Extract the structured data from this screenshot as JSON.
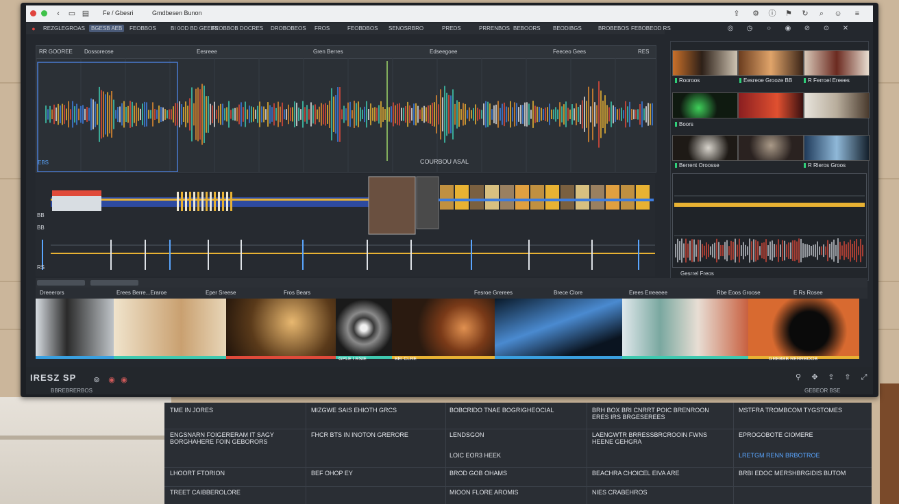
{
  "window": {
    "title_left": "Fe / Gbesri",
    "title_main": "Gmdbesen Bunon"
  },
  "toolbar": {
    "items": [
      "REZGLEGROAS",
      "BGESB AEB",
      "FEOBBOS",
      "BI 0OD BD GEEBS",
      "FEOBBOB DOCRES",
      "DROBOBEOS",
      "FROS",
      "FEOBDBOS",
      "SENOSRBRO",
      "PREDS",
      "PRRENBOS",
      "BEBOORS",
      "BEODIBGS",
      "BROBEBOS",
      "FEBOBEOD RS"
    ]
  },
  "waveform": {
    "header": [
      "RR GOOREE",
      "Dossoreose",
      "Eesreee",
      "Gren Berres",
      "Edseegoee",
      "Feeceo Gees",
      "RES"
    ],
    "overlay_label": "COURBOU ASAL",
    "corner_label": "EBS"
  },
  "lanes": {
    "labels": [
      "BB",
      "BB",
      "RS"
    ]
  },
  "browser": {
    "thumb_labels": [
      "Rooroos",
      "Eesreoe Grooze BB",
      "R Ferroel Ereees",
      "Boors",
      "Berrent Oroosse",
      "R Rleros Groos"
    ],
    "preview_label": "Gesrrel Freos"
  },
  "film": {
    "headers": [
      "Dreeerors",
      "Erees Berre...Eraroe",
      "Eper Sreese",
      "Fros Bears",
      "Fesroe Grerees",
      "Brece Clore",
      "Erees Erreeeee",
      "Rbe Eoos Groose",
      "E Rs Rosee"
    ],
    "tags": [
      "",
      "",
      "",
      "GPLE I RSIE",
      "BEI CLRE",
      "",
      "",
      "",
      "GREBBB RERRBOOB"
    ]
  },
  "footer": {
    "logo": "IRESZ SP",
    "left_text": "BBREBRERBOS",
    "right_text": "GEBEOR BSE"
  },
  "table": {
    "rows": [
      [
        "TME IN JORES",
        "MIZGWE SAIS EHIOTH GRCS",
        "BOBCRIDO TNAE BOGRIGHEOCIAL",
        "BRH BOX BRI CNRRT POIC BRENROON ERES IRS BRGESEREES",
        "MSTFRA TROMBCOM TYGSTOMES"
      ],
      [
        "ENGSNARN FOIGERERAM IT SAGY BORGHAHERE FOIN GEBORORS",
        "FHCR BTS IN INOTON GRERORE",
        "LENDSGON",
        "LAENGWTR BRRESSBRCROOIN FWNS HEENE GEHGRA",
        "EPROGOBOTE CIOMERE"
      ],
      [
        "",
        "",
        "LOIC EOR3 HEEK",
        "",
        "LRETGM RENN BRBOTROE"
      ],
      [
        "LHOORT FTORION",
        "BEF OHOP EY",
        "BROD GOB OHAMS",
        "BEACHRA CHOICEL EIVA ARE",
        "BRBI EDOC MERSHBRGIDIS BUTOM"
      ],
      [
        "TREET CAIBBEROLORE",
        "",
        "MIOON FLORE AROMIS",
        "NIES CRABEHROS",
        ""
      ]
    ],
    "link_cell": "LRETGM RENN BRBOTROE"
  },
  "colors": {
    "accent_green": "#2fd07a",
    "wave_yellow": "#e8b233",
    "wave_blue": "#3d7de0",
    "wave_red": "#e04a3a"
  }
}
